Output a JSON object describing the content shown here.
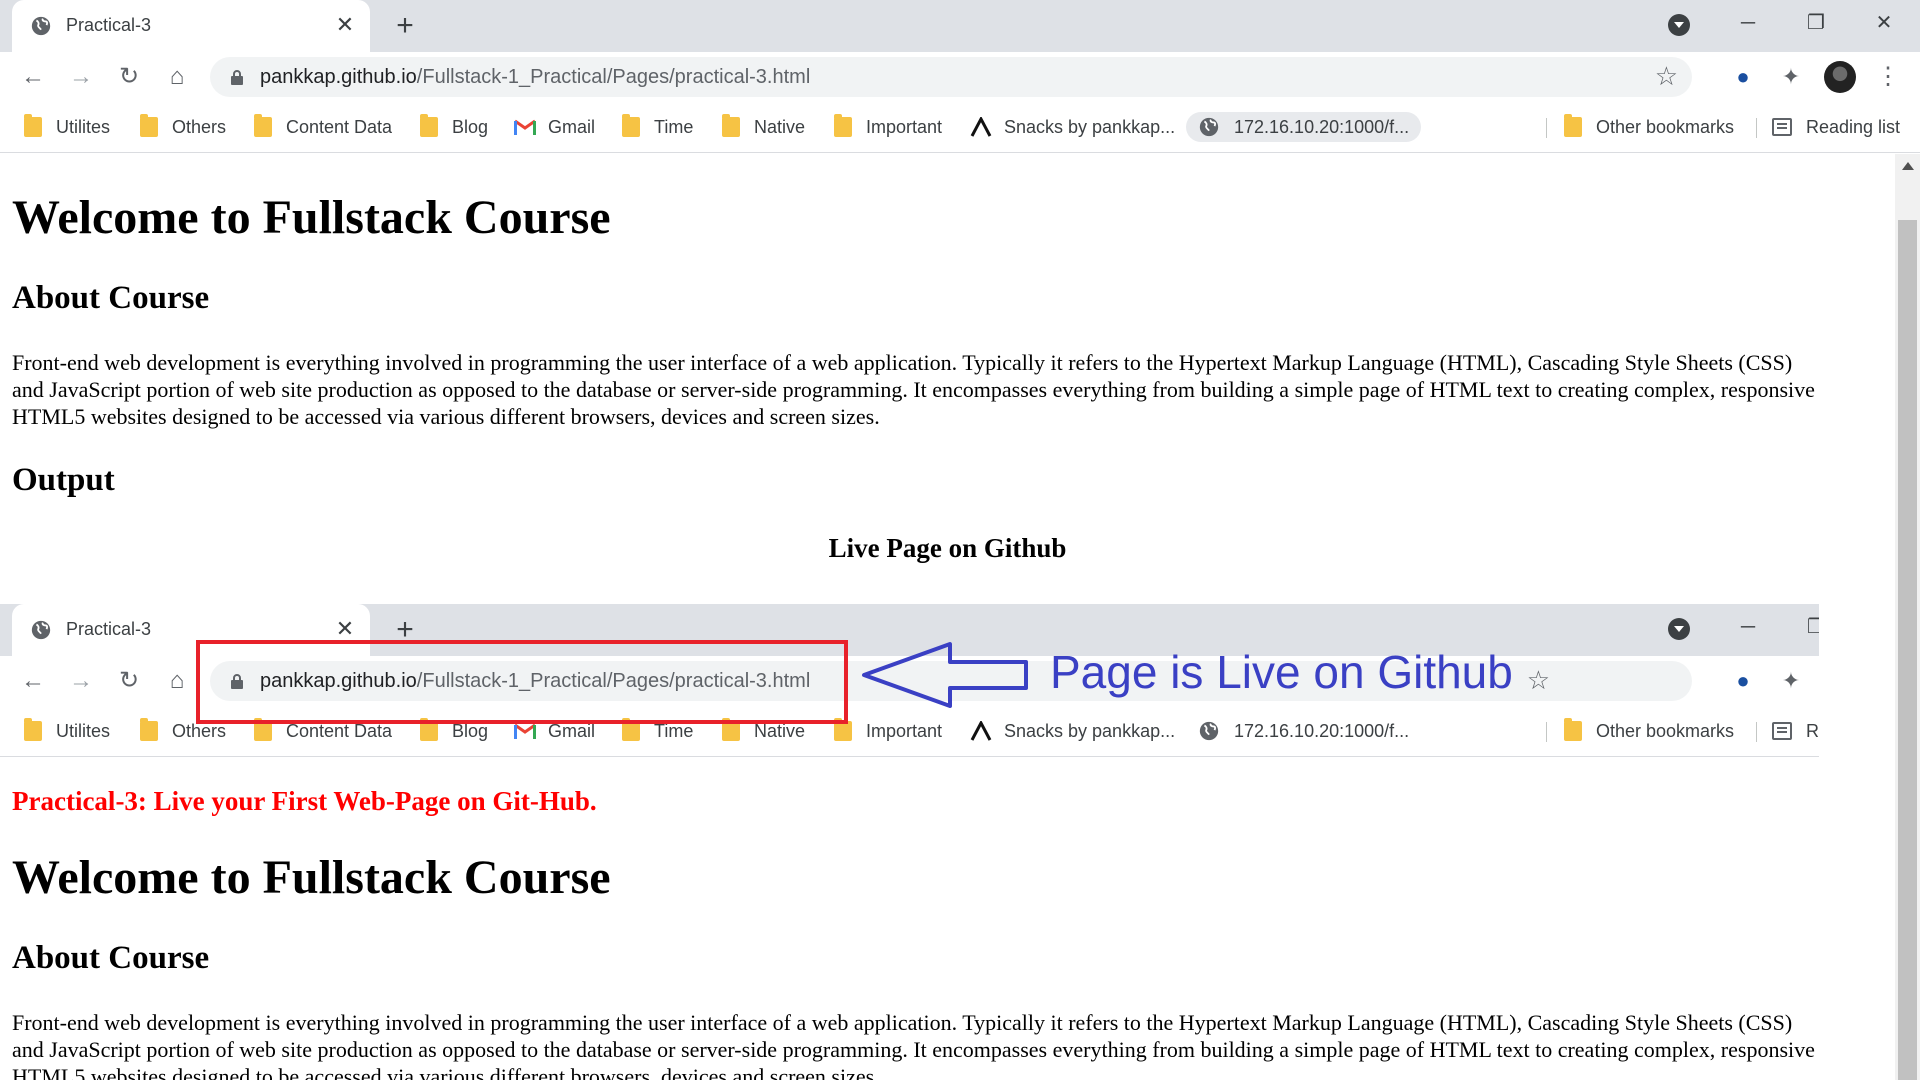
{
  "browser": {
    "tab_title": "Practical-3",
    "tab_close": "✕",
    "new_tab": "+",
    "window_controls": [
      "─",
      "❐",
      "✕"
    ],
    "url_host": "pankkap.github.io",
    "url_path": "/Fullstack-1_Practical/Pages/practical-3.html",
    "nav_icons": [
      "back-icon",
      "forward-icon",
      "reload-icon",
      "home-icon"
    ],
    "bookmarks": [
      {
        "label": "Utilites",
        "icon": "folder-icon"
      },
      {
        "label": "Others",
        "icon": "folder-icon"
      },
      {
        "label": "Content Data",
        "icon": "folder-icon"
      },
      {
        "label": "Blog",
        "icon": "folder-icon"
      },
      {
        "label": "Gmail",
        "icon": "gmail-icon"
      },
      {
        "label": "Time",
        "icon": "folder-icon"
      },
      {
        "label": "Native",
        "icon": "folder-icon"
      },
      {
        "label": "Important",
        "icon": "folder-icon"
      },
      {
        "label": "Snacks by pankkap...",
        "icon": "snacks-icon"
      },
      {
        "label": "172.16.10.20:1000/f...",
        "icon": "globe-icon"
      }
    ],
    "other_bookmarks": "Other bookmarks",
    "reading_list": "Reading list",
    "reading_list_truncated": "R",
    "colors": {
      "tabstrip": "#dee1e6",
      "folder": "#f6c344"
    }
  },
  "page": {
    "heading_red": "Practical-3: Live your First Web-Page on Git-Hub.",
    "title": "Welcome to Fullstack Course",
    "about_heading": "About Course",
    "about_text": "Front-end web development is everything involved in programming the user interface of a web application. Typically it refers to the Hypertext Markup Language (HTML), Cascading Style Sheets (CSS) and JavaScript portion of web site production as opposed to the database or server-side programming. It encompasses everything from building a simple page of HTML text to creating complex, responsive HTML5 websites designed to be accessed via various different browsers, devices and screen sizes.",
    "output_heading": "Output",
    "live_caption": "Live Page on Github"
  },
  "annotation": {
    "text": "Page is Live on Github",
    "color": "#3a40c4",
    "box_color": "#e8212a"
  }
}
